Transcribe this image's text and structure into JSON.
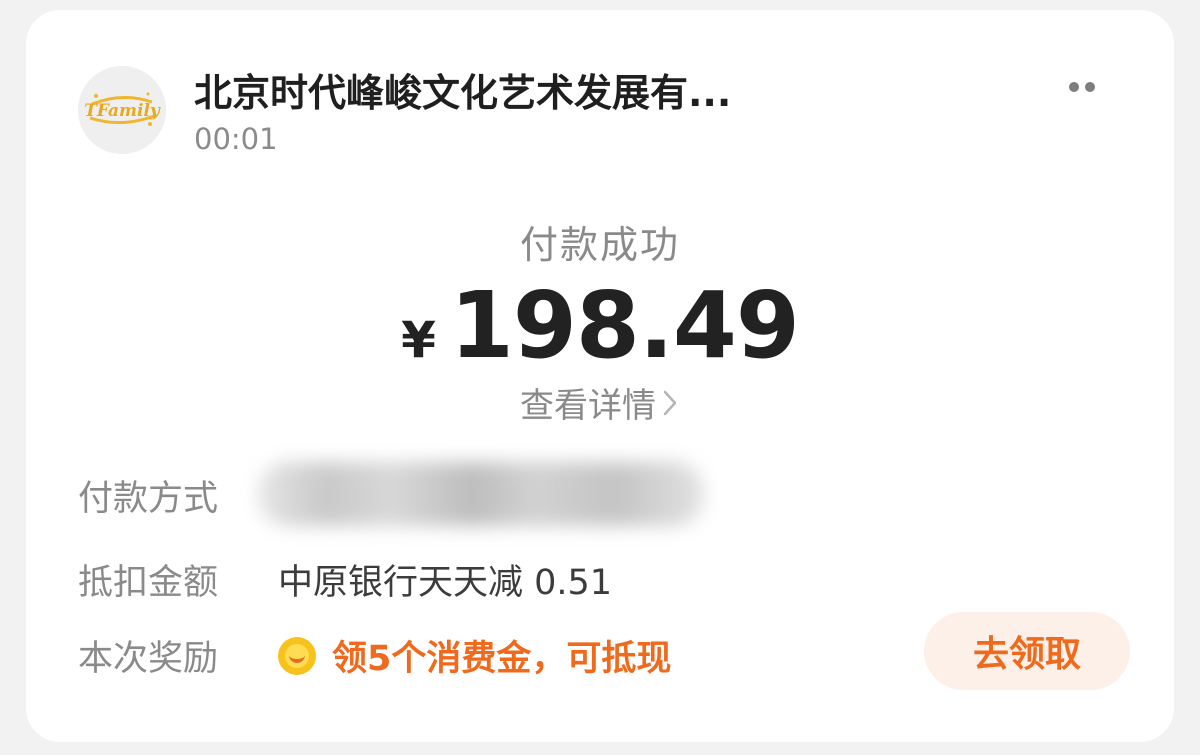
{
  "merchant": {
    "name": "北京时代峰峻文化艺术发展有...",
    "time": "00:01",
    "logo_text": "TFamily"
  },
  "payment": {
    "status": "付款成功",
    "currency": "¥",
    "amount": "198.49",
    "detail_label": "查看详情"
  },
  "details": {
    "method_label": "付款方式",
    "discount_label": "抵扣金额",
    "discount_value": "中原银行天天减 0.51",
    "reward_label": "本次奖励",
    "reward_text": "领5个消费金，可抵现",
    "claim_button": "去领取"
  },
  "colors": {
    "accent": "#ef6a1d",
    "claim_bg": "#fdf0e8",
    "coin": "#f7c21b"
  }
}
